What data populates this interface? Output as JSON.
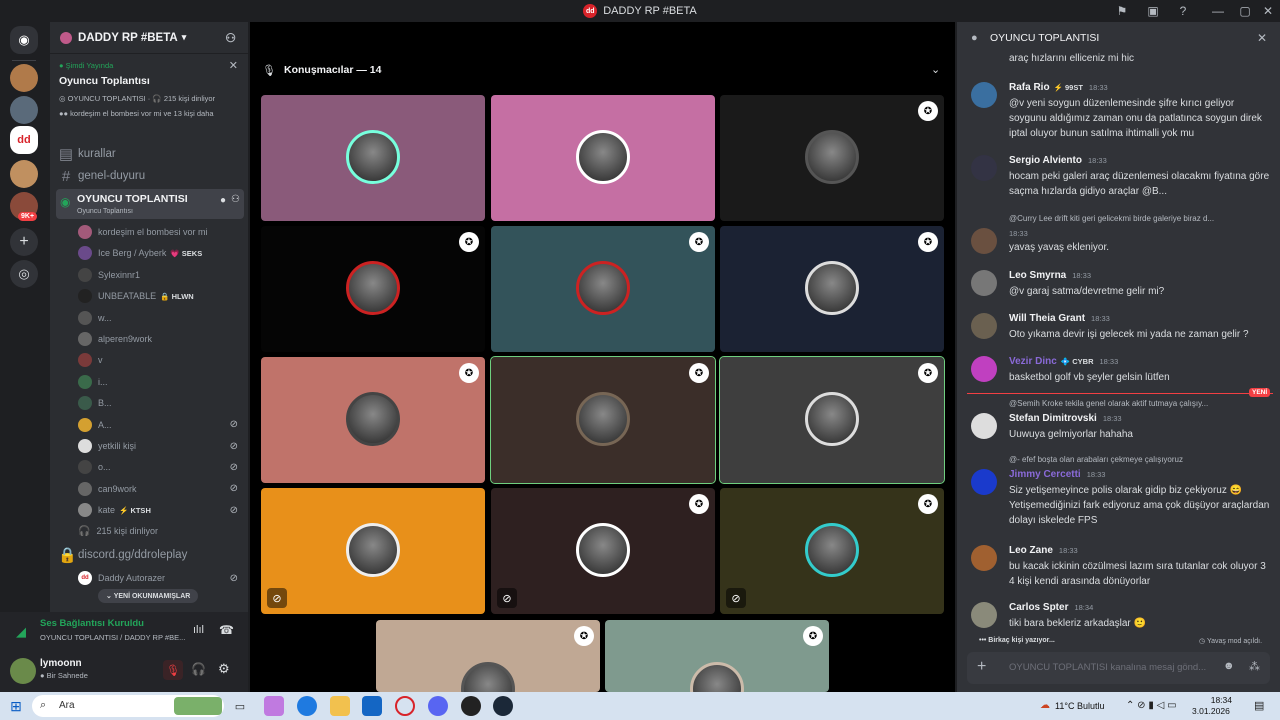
{
  "window": {
    "title": "DADDY RP #BETA",
    "controls": [
      "⚑",
      "▣",
      "?",
      "—",
      "▢",
      "✕"
    ]
  },
  "server": {
    "name": "DADDY RP #BETA"
  },
  "live": {
    "status": "Şimdi Yayında",
    "title": "Oyuncu Toplantısı",
    "channel": "OYUNCU TOPLANTISI",
    "listeners": "215 kişi dinliyor",
    "speakers": "kordeşim el bombesi vor mi ve 13 kişi daha"
  },
  "channels": [
    {
      "name": "kurallar",
      "icon": "▤"
    },
    {
      "name": "genel-duyuru",
      "icon": "#"
    }
  ],
  "active_channel": {
    "name": "OYUNCU TOPLANTISI",
    "sub": "Oyuncu Toplantısı"
  },
  "voice_users": [
    {
      "name": "kordeşim el bombesi vor mi",
      "tag": "",
      "color": "#a35a7a",
      "muted": false
    },
    {
      "name": "Ice Berg / Ayberk",
      "tag": "💗 SEKS",
      "color": "#6a4a8a",
      "muted": false
    },
    {
      "name": "Sylexinnr1",
      "tag": "",
      "color": "#444",
      "muted": false
    },
    {
      "name": "UNBEATABLE",
      "tag": "🔒 HLWN",
      "color": "#222",
      "muted": false
    },
    {
      "name": "w...",
      "tag": "",
      "color": "#555",
      "muted": false
    },
    {
      "name": "alperen9work",
      "tag": "",
      "color": "#666",
      "muted": false
    },
    {
      "name": "v",
      "tag": "",
      "color": "#7a3a3a",
      "muted": false
    },
    {
      "name": "i...",
      "tag": "",
      "color": "#3a6a4a",
      "muted": false
    },
    {
      "name": "B...",
      "tag": "",
      "color": "#3a5a4a",
      "muted": false
    },
    {
      "name": "A...",
      "tag": "",
      "color": "#d4a030",
      "muted": true
    },
    {
      "name": "yetkili kişi",
      "tag": "",
      "color": "#ddd",
      "muted": true
    },
    {
      "name": "o...",
      "tag": "",
      "color": "#444",
      "muted": true
    },
    {
      "name": "can9work",
      "tag": "",
      "color": "#666",
      "muted": true
    },
    {
      "name": "kate",
      "tag": "⚡ KTSH",
      "color": "#888",
      "muted": true
    }
  ],
  "listeners_row": "215 kişi dinliyor",
  "discord_link": "discord.gg/ddroleplay",
  "autorazer": "Daddy Autorazer",
  "unread_pill": "YENİ OKUNMAMIŞLAR",
  "voice_status": {
    "title": "Ses Bağlantısı Kuruldu",
    "sub": "OYUNCU TOPLANTISI / DADDY RP #BE..."
  },
  "user": {
    "name": "lymoonn",
    "status": "Bir Sahnede"
  },
  "stage": {
    "header": "Konuşmacılar — 14"
  },
  "tiles": [
    {
      "bg": "#8a5a7a",
      "ring": "#7fd",
      "badge": false,
      "mute": false,
      "border": false
    },
    {
      "bg": "#c56fa3",
      "ring": "#fff",
      "badge": false,
      "mute": false,
      "border": false
    },
    {
      "bg": "#1a1a1a",
      "ring": "#555",
      "badge": true,
      "mute": false,
      "border": false
    },
    {
      "bg": "#050505",
      "ring": "#c22",
      "badge": true,
      "mute": false,
      "border": false
    },
    {
      "bg": "#33535a",
      "ring": "#c22",
      "badge": true,
      "mute": false,
      "border": false
    },
    {
      "bg": "#1b2233",
      "ring": "#ddd",
      "badge": true,
      "mute": false,
      "border": false
    },
    {
      "bg": "#c0736a",
      "ring": "#444",
      "badge": true,
      "mute": false,
      "border": false
    },
    {
      "bg": "#3b2e29",
      "ring": "#765",
      "badge": true,
      "mute": false,
      "border": true
    },
    {
      "bg": "#3e3e3e",
      "ring": "#ddd",
      "badge": true,
      "mute": false,
      "border": true
    },
    {
      "bg": "#e8901a",
      "ring": "#eee",
      "badge": false,
      "mute": true,
      "border": false
    },
    {
      "bg": "#2e2020",
      "ring": "#fff",
      "badge": true,
      "mute": true,
      "border": false
    },
    {
      "bg": "#35331a",
      "ring": "#3cc",
      "badge": true,
      "mute": true,
      "border": false
    },
    {
      "bg": "#c0a894",
      "ring": "#555",
      "badge": true,
      "mute": false,
      "border": false
    },
    {
      "bg": "#7f9a8e",
      "ring": "#cba",
      "badge": true,
      "mute": false,
      "border": false
    }
  ],
  "chat": {
    "title": "OYUNCU TOPLANTISI",
    "top_text": "araç hızlarını elliceniz mi hic",
    "messages": [
      {
        "name": "Rafa Rio",
        "tag": "⚡ 99ST",
        "time": "18:33",
        "text": "@v yeni soygun düzenlemesinde şifre kırıcı geliyor soygunu aldığımız zaman onu da patlatınca soygun direk iptal oluyor bunun satılma ihtimalli yok mu",
        "color": "#3a6fa0",
        "reply": ""
      },
      {
        "name": "Sergio Alviento",
        "tag": "",
        "time": "18:33",
        "text": "hocam peki galeri araç düzenlemesi olacakmı fiyatına göre saçma hızlarda gidiyo araçlar @B...",
        "color": "#334",
        "reply": ""
      },
      {
        "name": "",
        "tag": "",
        "time": "18:33",
        "text": "yavaş yavaş ekleniyor.",
        "color": "#6a5040",
        "reply": "@Curry Lee drift kiti geri gelicekmi birde galeriye biraz d..."
      },
      {
        "name": "Leo Smyrna",
        "tag": "",
        "time": "18:33",
        "text": "@v garaj satma/devretme gelir mi?",
        "color": "#777",
        "reply": ""
      },
      {
        "name": "Will Theia Grant",
        "tag": "",
        "time": "18:33",
        "text": "Oto yıkama devir işi gelecek mi yada ne zaman gelir ?",
        "color": "#6a6050",
        "reply": ""
      },
      {
        "name": "Vezir Dinc",
        "tag": "💠 CYBR",
        "time": "18:33",
        "text": "basketbol golf vb şeyler gelsin lütfen",
        "color": "#c040c0",
        "reply": ""
      },
      {
        "name": "Stefan Dimitrovski",
        "tag": "",
        "time": "18:33",
        "text": "Uuwuya gelmiyorlar hahaha",
        "color": "#ddd",
        "reply": "@Semih Kroke tekila genel olarak aktif tutmaya çalışıy..."
      },
      {
        "name": "Jimmy Cercetti",
        "tag": "",
        "time": "18:33",
        "text": "Siz yetişemeyince polis olarak gidip biz çekiyoruz 😄 Yetişemediğinizi fark ediyoruz ama çok düşüyor araçlardan dolayı iskelede FPS",
        "color": "#1a3acc",
        "reply": "@- efef boşta olan arabaları çekmeye çalışıyoruz"
      },
      {
        "name": "Leo Zane",
        "tag": "",
        "time": "18:33",
        "text": "bu kacak ickinin cözülmesi lazım sıra tutanlar cok oluyor 3 4 kişi kendi arasında dönüyorlar",
        "color": "#a06030",
        "reply": ""
      },
      {
        "name": "Carlos Spter",
        "tag": "",
        "time": "18:34",
        "text": "tiki bara bekleriz arkadaşlar 🙂",
        "color": "#8a8a7a",
        "reply": ""
      }
    ],
    "new_label": "YENİ",
    "typing": "Birkaç kişi yazıyor...",
    "slowmode": "Yavaş mod açıldı.",
    "input_placeholder": "OYUNCU TOPLANTISI kanalına mesaj gönd..."
  },
  "taskbar": {
    "search": "Ara",
    "weather": "11°C  Bulutlu",
    "time": "18:34",
    "date": "3.01.2026"
  }
}
